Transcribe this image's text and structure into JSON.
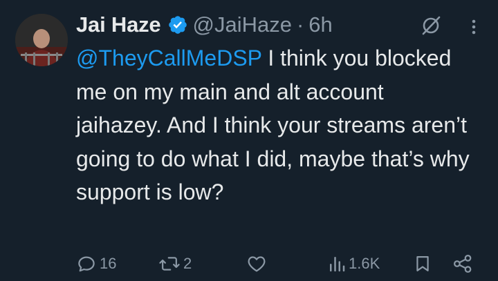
{
  "author": {
    "name": "Jai Haze",
    "handle": "@JaiHaze",
    "separator": "·",
    "time": "6h",
    "verified_color": "#1d9bf0"
  },
  "tweet": {
    "mention": "@TheyCallMeDSP",
    "text": " I think you blocked me on my main and alt account jaihazey. And I think your streams aren’t going to do what I did, maybe that’s why support is low?"
  },
  "actions": {
    "reply_count": "16",
    "retweet_count": "2",
    "views_count": "1.6K"
  },
  "colors": {
    "background": "#15202b",
    "text": "#e7e9ea",
    "muted": "#8b98a5",
    "accent": "#1d9bf0"
  },
  "icons": {
    "reply": "reply-icon",
    "retweet": "retweet-icon",
    "like": "heart-icon",
    "views": "views-icon",
    "bookmark": "bookmark-icon",
    "share": "share-icon",
    "grok": "grok-icon",
    "more": "more-icon",
    "verified": "verified-badge-icon"
  }
}
